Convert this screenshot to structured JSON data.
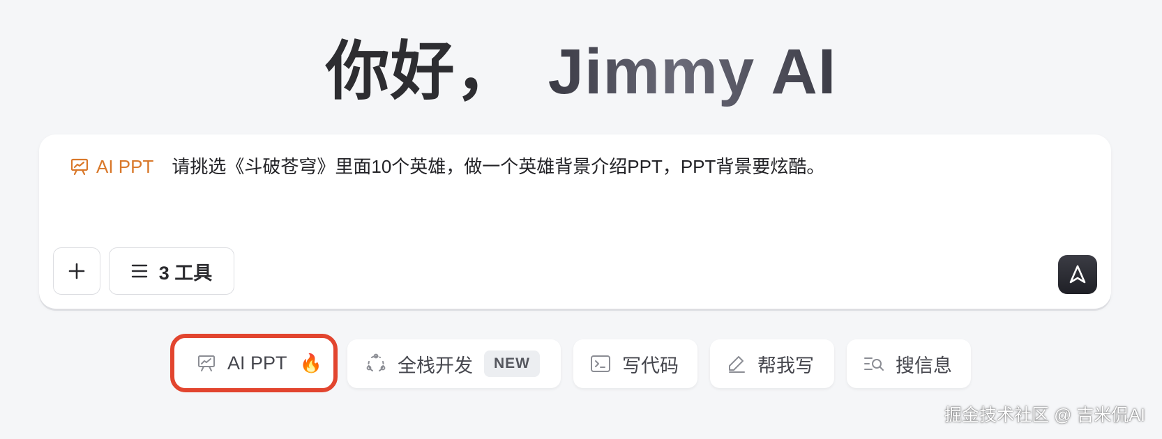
{
  "greeting": {
    "hello": "你好，",
    "name": "Jimmy AI"
  },
  "composer": {
    "skill_tag": "AI PPT",
    "prompt": "请挑选《斗破苍穹》里面10个英雄，做一个英雄背景介绍PPT，PPT背景要炫酷。",
    "tools_label": "3 工具",
    "plus_icon": "plus-icon",
    "send_icon": "send-arrow-icon"
  },
  "chips": [
    {
      "label": "AI PPT",
      "icon": "presentation-icon",
      "emoji": "🔥",
      "highlighted": true
    },
    {
      "label": "全栈开发",
      "icon": "fullstack-icon",
      "badge": "NEW"
    },
    {
      "label": "写代码",
      "icon": "terminal-icon"
    },
    {
      "label": "帮我写",
      "icon": "pen-icon"
    },
    {
      "label": "搜信息",
      "icon": "search-list-icon"
    }
  ],
  "watermark": "掘金技术社区 @ 吉米侃AI",
  "colors": {
    "accent_orange": "#d9782a",
    "highlight_red": "#e2452f",
    "background": "#f5f6f8"
  }
}
